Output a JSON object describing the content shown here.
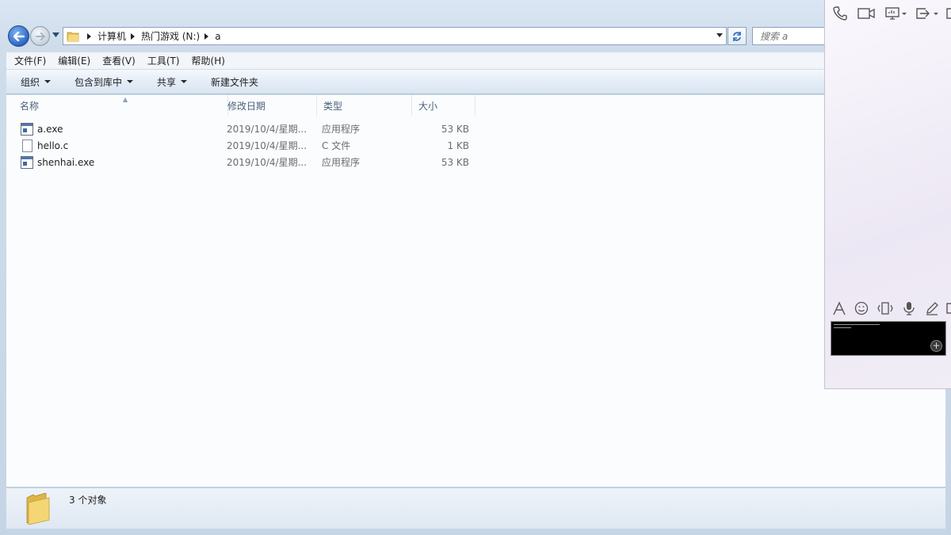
{
  "address": {
    "breadcrumbs": [
      "计算机",
      "热门游戏 (N:)",
      "a"
    ],
    "search_placeholder": "搜索 a"
  },
  "menu": [
    "文件(F)",
    "编辑(E)",
    "查看(V)",
    "工具(T)",
    "帮助(H)"
  ],
  "commands": {
    "organize": "组织",
    "include_in_library": "包含到库中",
    "share": "共享",
    "new_folder": "新建文件夹"
  },
  "columns": {
    "name": "名称",
    "modified": "修改日期",
    "type": "类型",
    "size": "大小"
  },
  "files": [
    {
      "name": "a.exe",
      "modified": "2019/10/4/星期...",
      "type": "应用程序",
      "size": "53 KB",
      "icon": "exe-icon"
    },
    {
      "name": "hello.c",
      "modified": "2019/10/4/星期...",
      "type": "C 文件",
      "size": "1 KB",
      "icon": "c-file-icon"
    },
    {
      "name": "shenhai.exe",
      "modified": "2019/10/4/星期...",
      "type": "应用程序",
      "size": "53 KB",
      "icon": "exe-icon"
    }
  ],
  "status": {
    "count_text": "3 个对象"
  },
  "chat": {
    "top_icons": [
      "phone-icon",
      "video-icon",
      "screen-share-icon",
      "transfer-icon"
    ],
    "tool_icons": [
      "font-icon",
      "emoji-icon",
      "shake-icon",
      "voice-icon",
      "draw-icon"
    ]
  }
}
